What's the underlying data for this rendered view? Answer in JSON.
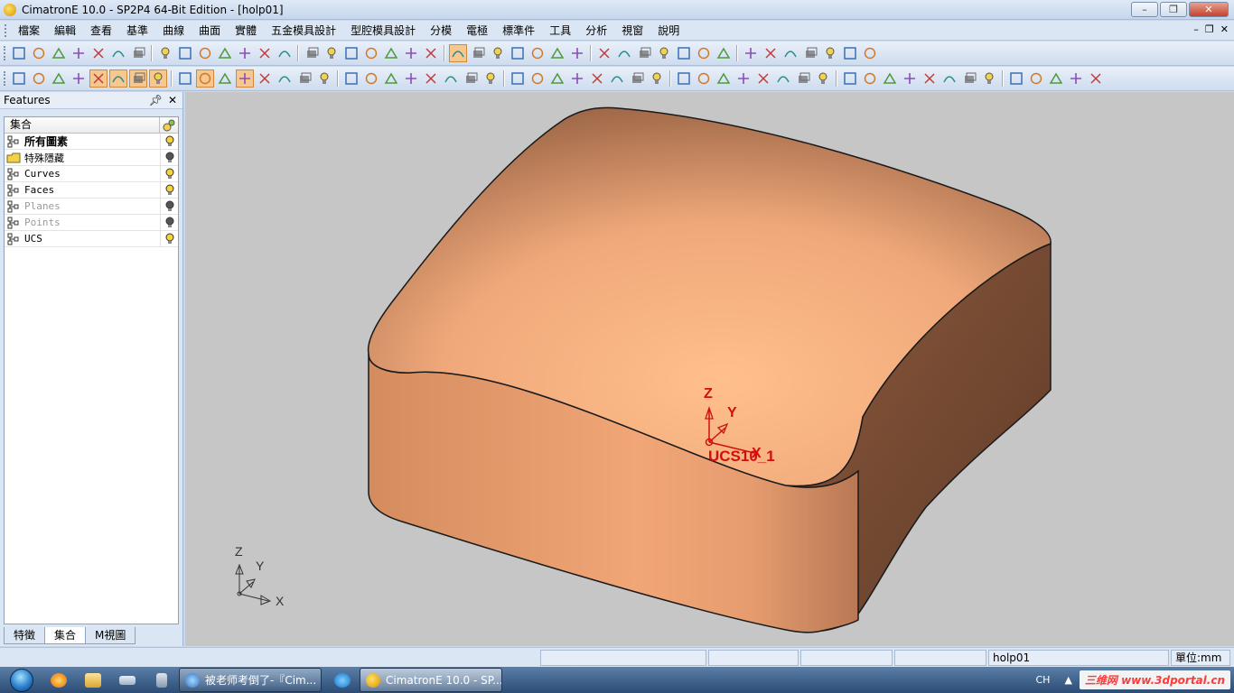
{
  "window": {
    "title": "CimatronE 10.0 - SP2P4 64-Bit Edition - [holp01]",
    "controls": [
      "minimize",
      "maximize",
      "close"
    ]
  },
  "menu": {
    "items": [
      "檔案",
      "編輯",
      "查看",
      "基準",
      "曲線",
      "曲面",
      "實體",
      "五金模具設計",
      "型腔模具設計",
      "分模",
      "電極",
      "標準件",
      "工具",
      "分析",
      "視窗",
      "說明"
    ]
  },
  "toolbars": {
    "row1_icons": [
      "new-file-icon",
      "open-file-icon",
      "save-icon",
      "undo-icon",
      "redo-icon",
      "link-icon",
      "feature-icon",
      "layout-icon",
      "zoom-fit-icon",
      "zoom-window-icon",
      "zoom-dynamic-icon",
      "zoom-icon",
      "pan-icon",
      "rotate-icon",
      "view-iso-icon",
      "view-front-icon",
      "view-top-icon",
      "view-right-icon",
      "view-left-icon",
      "view-back-icon",
      "view-settings-icon",
      "view-icon",
      "shading-icon",
      "wireframe-icon",
      "render-icon",
      "display-icon",
      "light-off-icon",
      "light-on-icon",
      "light-icon",
      "prev-icon",
      "next-icon",
      "tree-icon",
      "measure-icon",
      "settings-icon",
      "copy-icon",
      "paste-icon",
      "color-icon",
      "fill-icon",
      "pen-icon",
      "pattern-icon",
      "lines-icon",
      "cube-icon"
    ],
    "row2_icons": [
      "select-icon",
      "delete-icon",
      "select-filter-icon",
      "pick-icon",
      "filter1-icon",
      "filter2-icon",
      "filter3-icon",
      "filter4-icon",
      "text-icon",
      "filter5-icon",
      "filter6-icon",
      "filter7-icon",
      "filter8-icon",
      "filter9-icon",
      "list-icon",
      "pointer-icon",
      "smart-icon",
      "sketch-icon",
      "shape-icon",
      "point-icon",
      "line-icon",
      "arc-icon",
      "circle-icon",
      "curve1-icon",
      "curve2-icon",
      "curve3-icon",
      "curve4-icon",
      "curve5-icon",
      "surface1-icon",
      "surface2-icon",
      "surface3-icon",
      "surface4-icon",
      "surface5-icon",
      "surface6-icon",
      "surface7-icon",
      "solid1-icon",
      "solid2-icon",
      "solid3-icon",
      "solid4-icon",
      "solid5-icon",
      "solid6-icon",
      "solid7-icon",
      "solid8-icon",
      "solid9-icon",
      "solid10-icon",
      "solid11-icon",
      "solid12-icon",
      "solid13-icon",
      "solid14-icon",
      "solid15-icon",
      "solid16-icon",
      "solid17-icon",
      "solid18-icon"
    ]
  },
  "features_panel": {
    "title": "Features",
    "column_header": "集合",
    "rows": [
      {
        "label": "所有圖素",
        "style": "bold",
        "icon": "hierarchy-icon",
        "bulb": "on"
      },
      {
        "label": "特殊隱藏",
        "style": "normal",
        "icon": "folder-icon",
        "bulb": "off"
      },
      {
        "label": "Curves",
        "style": "normal",
        "icon": "hierarchy-icon",
        "bulb": "on"
      },
      {
        "label": "Faces",
        "style": "normal",
        "icon": "hierarchy-icon",
        "bulb": "on"
      },
      {
        "label": "Planes",
        "style": "dim",
        "icon": "hierarchy-icon",
        "bulb": "off"
      },
      {
        "label": "Points",
        "style": "dim",
        "icon": "hierarchy-icon",
        "bulb": "off"
      },
      {
        "label": "UCS",
        "style": "normal",
        "icon": "hierarchy-icon",
        "bulb": "on"
      }
    ],
    "tabs": [
      "特徵",
      "集合",
      "M視圖"
    ],
    "active_tab": "集合"
  },
  "viewport": {
    "ucs_label": "UCS10_1",
    "ucs_axes": {
      "z": "Z",
      "y": "Y",
      "x": "X"
    },
    "triad_axes": {
      "z": "Z",
      "y": "Y",
      "x": "X"
    },
    "model_color": "#f0a87a",
    "background": "#c6c6c6"
  },
  "statusbar": {
    "file": "holp01",
    "unit": "單位:mm"
  },
  "taskbar": {
    "tasks": [
      "被老师考倒了-『Cim...",
      "CimatronE 10.0 - SP..."
    ],
    "active_task": 1,
    "lang": "CH",
    "watermark": "三维网 www.3dportal.cn"
  }
}
